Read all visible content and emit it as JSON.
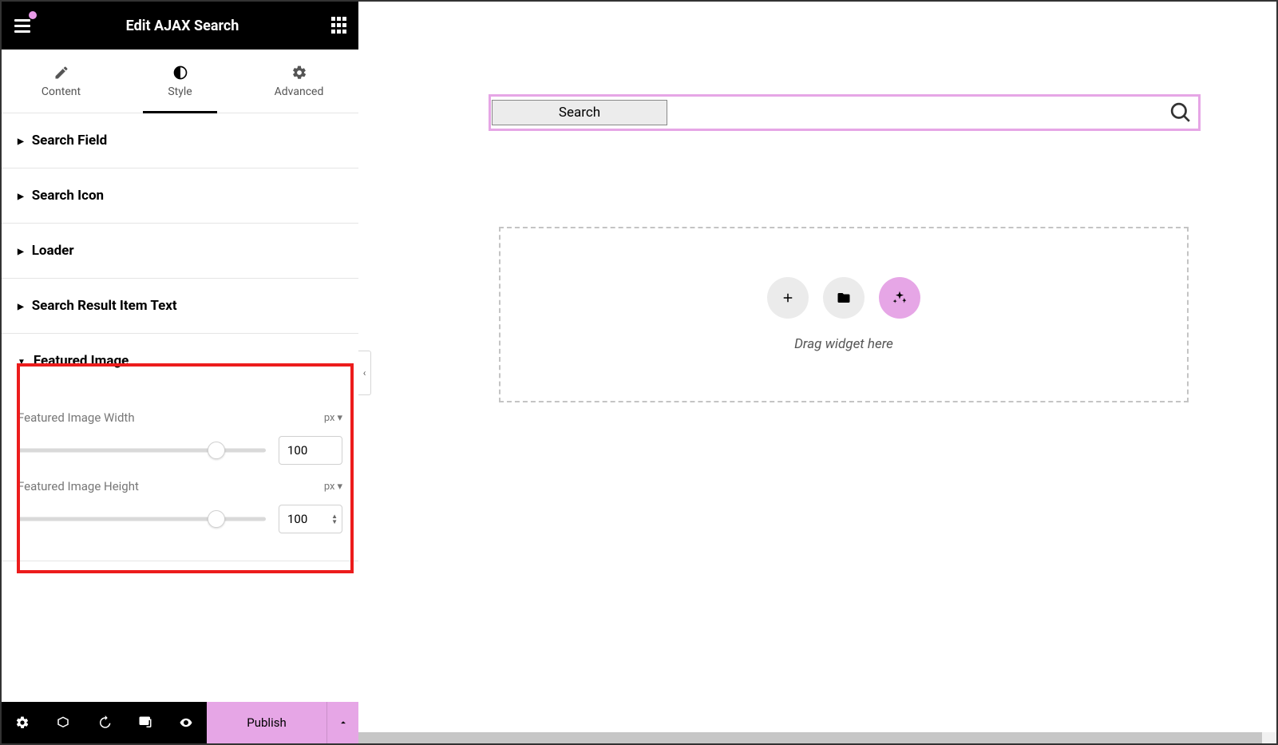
{
  "header": {
    "title": "Edit AJAX Search"
  },
  "tabs": {
    "content": "Content",
    "style": "Style",
    "advanced": "Advanced"
  },
  "sections": {
    "search_field": "Search Field",
    "search_icon": "Search Icon",
    "loader": "Loader",
    "search_result_text": "Search Result Item Text",
    "featured_image": "Featured Image"
  },
  "featured_image": {
    "width": {
      "label": "Featured Image Width",
      "unit": "px",
      "value": "100",
      "percent": 80
    },
    "height": {
      "label": "Featured Image Height",
      "unit": "px",
      "value": "100",
      "percent": 80
    }
  },
  "canvas": {
    "search_label": "Search",
    "drop_text": "Drag widget here"
  },
  "footer": {
    "publish": "Publish"
  }
}
